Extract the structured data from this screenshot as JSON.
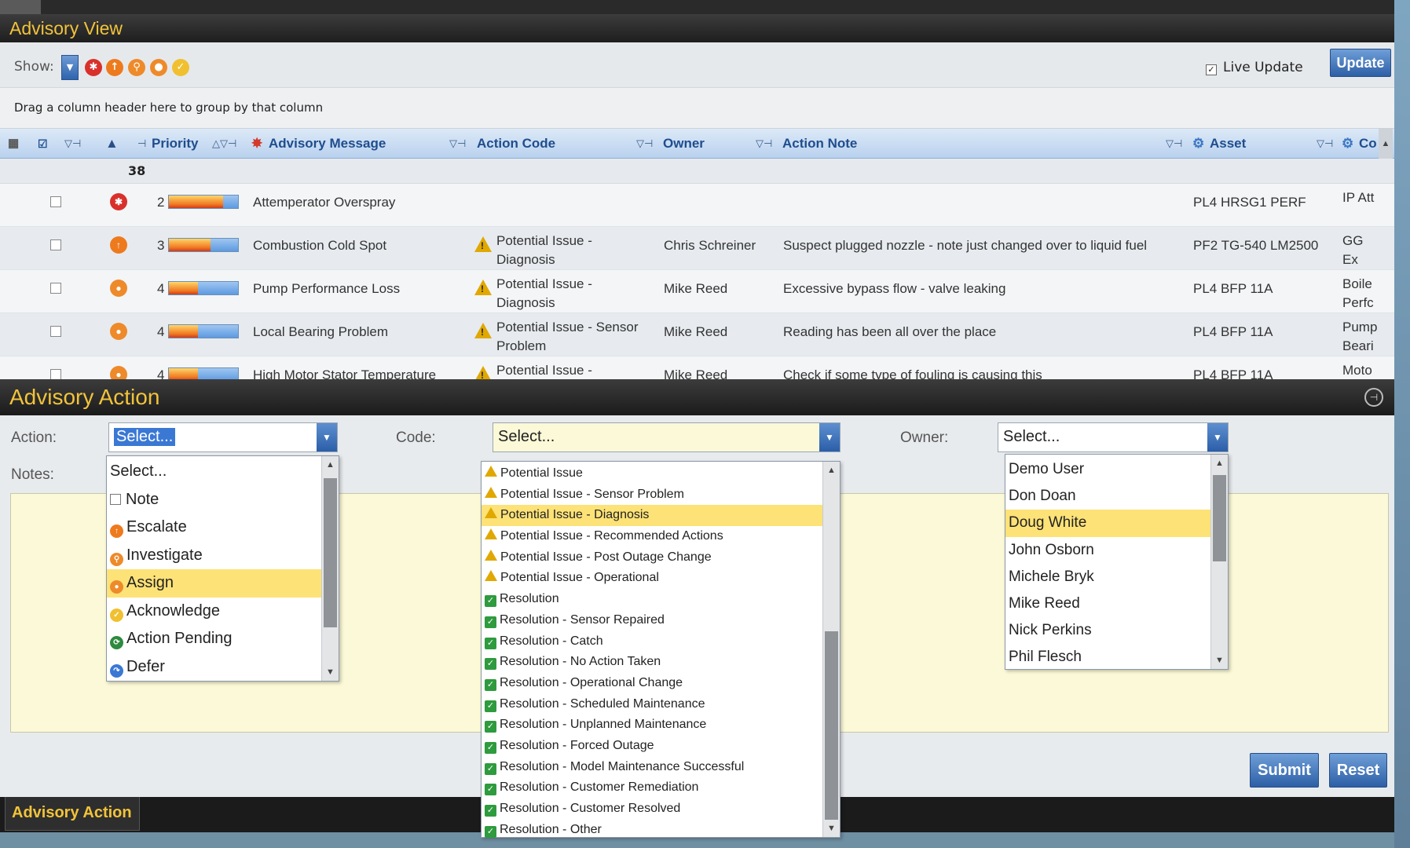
{
  "advisory_view": {
    "title": "Advisory View",
    "show_label": "Show:",
    "live_update_label": "Live Update",
    "update_button": "Update",
    "group_hint": "Drag a column header here to group by that column",
    "columns": {
      "priority": "Priority",
      "message": "Advisory Message",
      "action_code": "Action Code",
      "owner": "Owner",
      "action_note": "Action Note",
      "asset": "Asset",
      "co": "Co"
    },
    "group_count": "38",
    "rows": [
      {
        "priority": "2",
        "fill": 0.78,
        "icon_color": "#d9302b",
        "message": "Attemperator Overspray",
        "code": "",
        "owner": "",
        "note": "",
        "asset": "PL4 HRSG1 PERF",
        "co": "IP Att"
      },
      {
        "priority": "3",
        "fill": 0.6,
        "icon_color": "#ee7a1e",
        "message": "Combustion Cold Spot",
        "code": "Potential Issue - Diagnosis",
        "owner": "Chris Schreiner",
        "note": "Suspect plugged nozzle - note just changed over to liquid fuel",
        "asset": "PF2 TG-540 LM2500",
        "co": "GG Ex"
      },
      {
        "priority": "4",
        "fill": 0.42,
        "icon_color": "#ee8a2a",
        "message": "Pump Performance Loss",
        "code": "Potential Issue - Diagnosis",
        "owner": "Mike Reed",
        "note": "Excessive bypass flow - valve leaking",
        "asset": "PL4 BFP 11A",
        "co": "Boile Perfc"
      },
      {
        "priority": "4",
        "fill": 0.42,
        "icon_color": "#ee8a2a",
        "message": "Local Bearing Problem",
        "code": "Potential Issue - Sensor Problem",
        "owner": "Mike Reed",
        "note": "Reading has been all over the place",
        "asset": "PL4 BFP 11A",
        "co": "Pump Beari"
      },
      {
        "priority": "4",
        "fill": 0.42,
        "icon_color": "#ee8a2a",
        "message": "High Motor Stator Temperature",
        "code": "Potential Issue -",
        "owner": "Mike Reed",
        "note": "Check if some type of fouling is causing this",
        "asset": "PL4 BFP 11A",
        "co": "Moto"
      }
    ]
  },
  "advisory_action": {
    "title": "Advisory Action",
    "action_label": "Action:",
    "code_label": "Code:",
    "owner_label": "Owner:",
    "notes_label": "Notes:",
    "action_value": "Select...",
    "code_value": "Select...",
    "owner_value": "Select...",
    "submit_button": "Submit",
    "reset_button": "Reset",
    "bottom_tab": "Advisory Action",
    "action_options": [
      {
        "label": "Select...",
        "icon": "none"
      },
      {
        "label": "Note",
        "icon": "note-icon"
      },
      {
        "label": "Escalate",
        "icon": "escalate-icon"
      },
      {
        "label": "Investigate",
        "icon": "investigate-icon"
      },
      {
        "label": "Assign",
        "icon": "assign-icon",
        "selected": true
      },
      {
        "label": "Acknowledge",
        "icon": "acknowledge-icon"
      },
      {
        "label": "Action Pending",
        "icon": "action-pending-icon"
      },
      {
        "label": "Defer",
        "icon": "defer-icon"
      }
    ],
    "code_options": [
      {
        "label": "Potential Issue",
        "icon": "warning-icon"
      },
      {
        "label": "Potential Issue - Sensor Problem",
        "icon": "warning-icon"
      },
      {
        "label": "Potential Issue - Diagnosis",
        "icon": "warning-icon",
        "selected": true
      },
      {
        "label": "Potential Issue - Recommended Actions",
        "icon": "warning-icon"
      },
      {
        "label": "Potential Issue - Post Outage Change",
        "icon": "warning-icon"
      },
      {
        "label": "Potential Issue - Operational",
        "icon": "warning-icon"
      },
      {
        "label": "Resolution",
        "icon": "check-icon"
      },
      {
        "label": "Resolution - Sensor Repaired",
        "icon": "check-icon"
      },
      {
        "label": "Resolution - Catch",
        "icon": "check-icon"
      },
      {
        "label": "Resolution - No Action Taken",
        "icon": "check-icon"
      },
      {
        "label": "Resolution - Operational Change",
        "icon": "check-icon"
      },
      {
        "label": "Resolution - Scheduled Maintenance",
        "icon": "check-icon"
      },
      {
        "label": "Resolution - Unplanned Maintenance",
        "icon": "check-icon"
      },
      {
        "label": "Resolution - Forced Outage",
        "icon": "check-icon"
      },
      {
        "label": "Resolution - Model Maintenance Successful",
        "icon": "check-icon"
      },
      {
        "label": "Resolution - Customer Remediation",
        "icon": "check-icon"
      },
      {
        "label": "Resolution - Customer Resolved",
        "icon": "check-icon"
      },
      {
        "label": "Resolution - Other",
        "icon": "check-icon"
      }
    ],
    "owner_options": [
      {
        "label": "Demo User"
      },
      {
        "label": "Don Doan"
      },
      {
        "label": "Doug White",
        "selected": true
      },
      {
        "label": "John Osborn"
      },
      {
        "label": "Michele Bryk"
      },
      {
        "label": "Mike Reed"
      },
      {
        "label": "Nick Perkins"
      },
      {
        "label": "Phil Flesch"
      }
    ]
  },
  "colors": {
    "title_text": "#f2c33a",
    "selection": "#fde277",
    "header_text": "#1f4d8e",
    "notes_bg": "#fbf9d7"
  }
}
